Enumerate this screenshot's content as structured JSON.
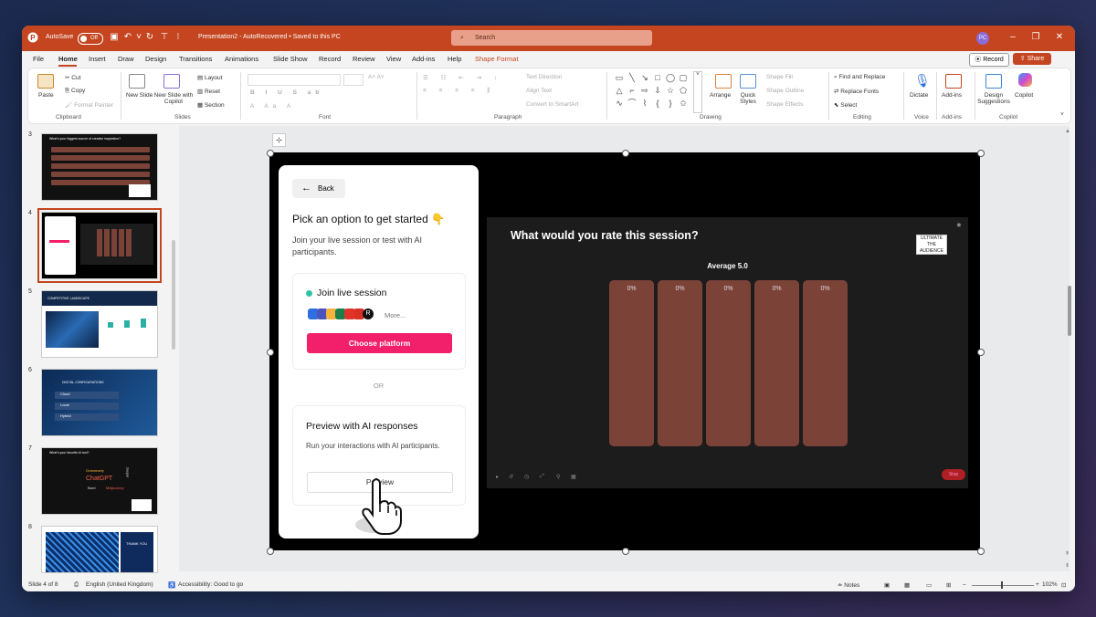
{
  "titlebar": {
    "autosave_label": "AutoSave",
    "autosave_state": "Off",
    "document_title": "Presentation2  -  AutoRecovered  •  Saved to this PC",
    "search_placeholder": "Search",
    "user_initials": "PC"
  },
  "menu": {
    "tabs": [
      "File",
      "Home",
      "Insert",
      "Draw",
      "Design",
      "Transitions",
      "Animations",
      "Slide Show",
      "Record",
      "Review",
      "View",
      "Add-ins",
      "Help",
      "Shape Format"
    ],
    "active_tab": "Home",
    "record_label": "Record",
    "share_label": "Share"
  },
  "ribbon": {
    "paste": "Paste",
    "cut": "Cut",
    "copy": "Copy",
    "format_painter": "Format Painter",
    "clipboard": "Clipboard",
    "new_slide": "New Slide",
    "new_slide_copilot": "New Slide with Copilot",
    "layout": "Layout",
    "reset": "Reset",
    "section": "Section",
    "slides": "Slides",
    "font": "Font",
    "text_direction": "Text Direction",
    "align_text": "Align Text",
    "convert_smartart": "Convert to SmartArt",
    "paragraph": "Paragraph",
    "arrange": "Arrange",
    "quick_styles": "Quick Styles",
    "shape_fill": "Shape Fill",
    "shape_outline": "Shape Outline",
    "shape_effects": "Shape Effects",
    "drawing": "Drawing",
    "find_replace": "Find and Replace",
    "replace_fonts": "Replace Fonts",
    "select": "Select",
    "editing": "Editing",
    "dictate": "Dictate",
    "voice": "Voice",
    "addins_btn": "Add-ins",
    "addins_grp": "Add-ins",
    "designer": "Design Suggestions",
    "copilot_btn": "Copilot",
    "copilot_grp": "Copilot"
  },
  "thumbnails": {
    "numbers": [
      "3",
      "4",
      "5",
      "6",
      "7",
      "8"
    ],
    "slide3_title": "What's your biggest source of creative inspiration?",
    "slide5_title": "COMPETITIVE LANDSCAPE",
    "slide6_title": "DIGITAL CONFIGURATIONS",
    "slide6_items": [
      "Cloud",
      "Local",
      "Hybrid"
    ],
    "slide7_title": "What's your favorite AI tool?",
    "slide7_words": [
      "Grammarly",
      "ChatGPT",
      "Bard",
      "Midjourney",
      "Jasper"
    ],
    "slide8_text": "THANK YOU"
  },
  "panel": {
    "back_label": "Back",
    "title": "Pick an option to get started 👇",
    "subtitle": "Join your live session or test with AI participants.",
    "join_title": "Join live session",
    "more_label": "More...",
    "choose_btn": "Choose platform",
    "or_label": "OR",
    "preview_title": "Preview with AI responses",
    "preview_desc": "Run your interactions with AI participants.",
    "preview_btn": "Preview"
  },
  "presenter": {
    "question": "What would you rate this session?",
    "average": "Average 5.0",
    "brand_text": "ULTIMATE THE AUDIENCE",
    "stop_label": "Stop",
    "bars": [
      {
        "label": "0%",
        "value": 0
      },
      {
        "label": "0%",
        "value": 0
      },
      {
        "label": "0%",
        "value": 0
      },
      {
        "label": "0%",
        "value": 0
      },
      {
        "label": "0%",
        "value": 0
      }
    ]
  },
  "status": {
    "slide_counter": "Slide 4 of 8",
    "language": "English (United Kingdom)",
    "accessibility": "Accessibility: Good to go",
    "notes": "Notes",
    "zoom": "102%"
  },
  "colors": {
    "accent": "#c4451f",
    "pink": "#f2206a",
    "bar": "#7b4238",
    "live_dot": "#2ec4a6"
  }
}
